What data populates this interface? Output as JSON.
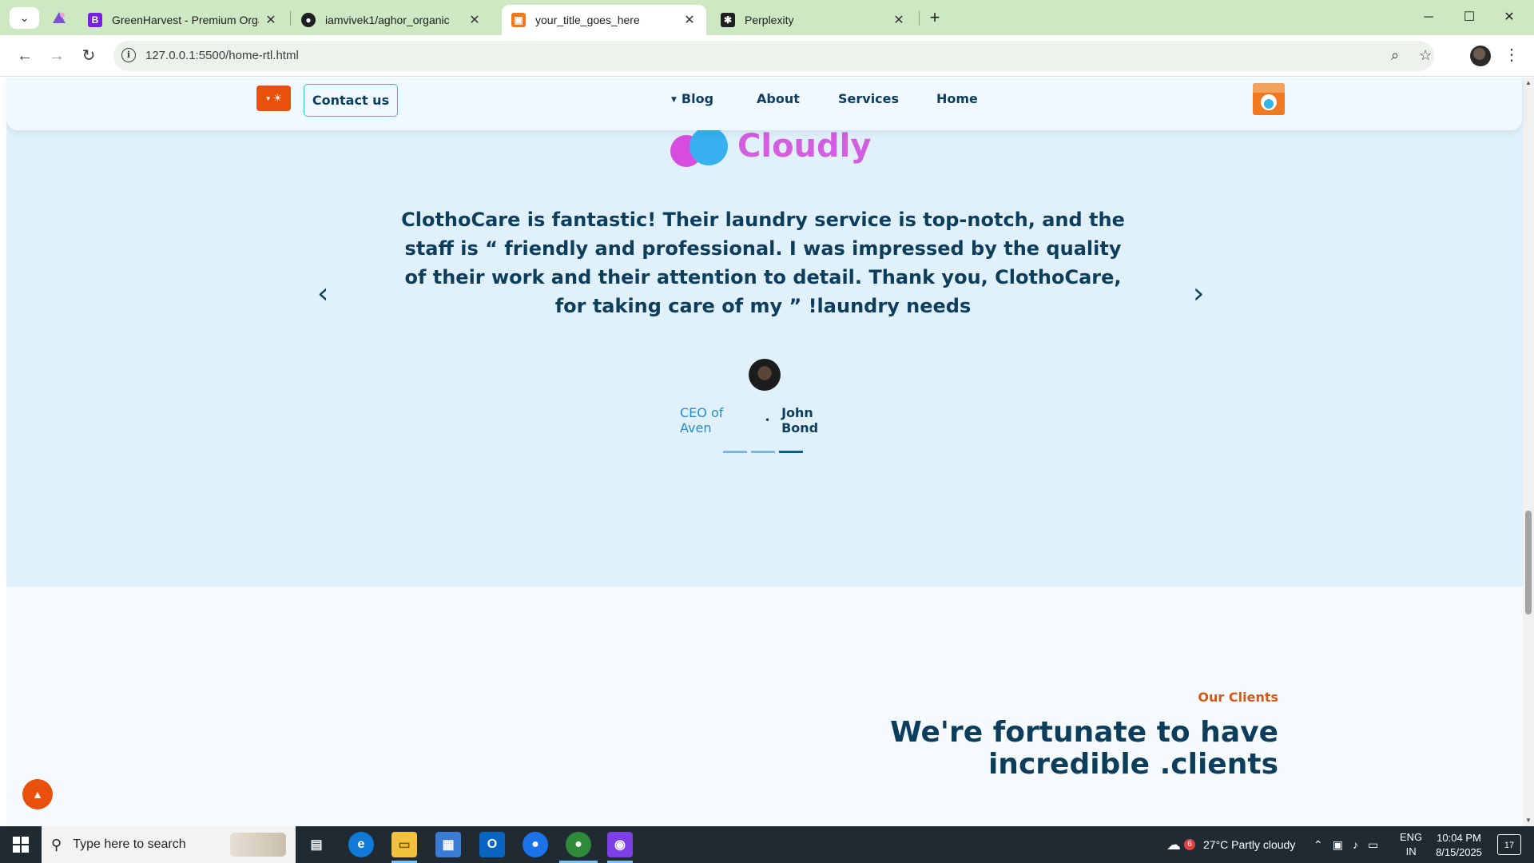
{
  "browser": {
    "tabs": [
      {
        "title": "GreenHarvest - Premium Organ",
        "icon": "bootstrap-icon",
        "active": false
      },
      {
        "title": "iamvivek1/aghor_organic",
        "icon": "github-icon",
        "active": false
      },
      {
        "title": "your_title_goes_here",
        "icon": "site-logo-icon",
        "active": true
      },
      {
        "title": "Perplexity",
        "icon": "perplexity-icon",
        "active": false
      }
    ],
    "url": "127.0.0.1:5500/home-rtl.html"
  },
  "header": {
    "contact_label": "Contact us",
    "nav": [
      "Blog",
      "About",
      "Services",
      "Home"
    ]
  },
  "testimonial": {
    "brand": "Cloudly",
    "quote": "ClothoCare is fantastic! Their laundry service is top-notch, and the staff is “ friendly and professional. I was impressed by the quality of their work and their attention to detail. Thank you, ClothoCare, for taking care of my ” !laundry needs",
    "author_role": "CEO of Aven",
    "author_name": "John Bond",
    "slides_total": 3,
    "slide_active": 3
  },
  "clients": {
    "eyebrow": "Our Clients",
    "title": "We're fortunate to have incredible .clients"
  },
  "taskbar": {
    "search_placeholder": "Type here to search",
    "weather": "27°C  Partly cloudy",
    "weather_badge": "6",
    "lang_top": "ENG",
    "lang_bottom": "IN",
    "time": "10:04 PM",
    "date": "8/15/2025",
    "notification_count": "17"
  },
  "colors": {
    "accent": "#e8500c",
    "heading": "#0c3e5c",
    "testimonial_bg": "#e0f1fb",
    "brand_pink": "#d35ee0",
    "brand_blue": "#37b1f0"
  }
}
